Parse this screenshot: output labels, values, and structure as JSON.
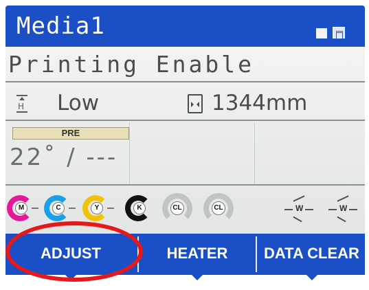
{
  "header": {
    "title": "Media1"
  },
  "status": {
    "text": "Printing Enable"
  },
  "heater": {
    "level": "Low"
  },
  "media": {
    "length": "1344mm"
  },
  "temperature": {
    "label": "PRE",
    "value": "22˚ / ---"
  },
  "inks": [
    {
      "label": "M",
      "color": "#e6189a"
    },
    {
      "label": "C",
      "color": "#1aa0e6"
    },
    {
      "label": "Y",
      "color": "#f2c20a"
    },
    {
      "label": "K",
      "color": "#111111"
    },
    {
      "label": "CL",
      "color": "#bfc4c6"
    },
    {
      "label": "CL",
      "color": "#bfc4c6"
    },
    {
      "label": "W",
      "color": "#ffffff"
    },
    {
      "label": "W",
      "color": "#ffffff"
    }
  ],
  "footer": {
    "buttons": [
      "ADJUST",
      "HEATER",
      "DATA CLEAR"
    ]
  },
  "colors": {
    "bar_blue": "#1b4fc6",
    "highlight_red": "#e51919"
  }
}
